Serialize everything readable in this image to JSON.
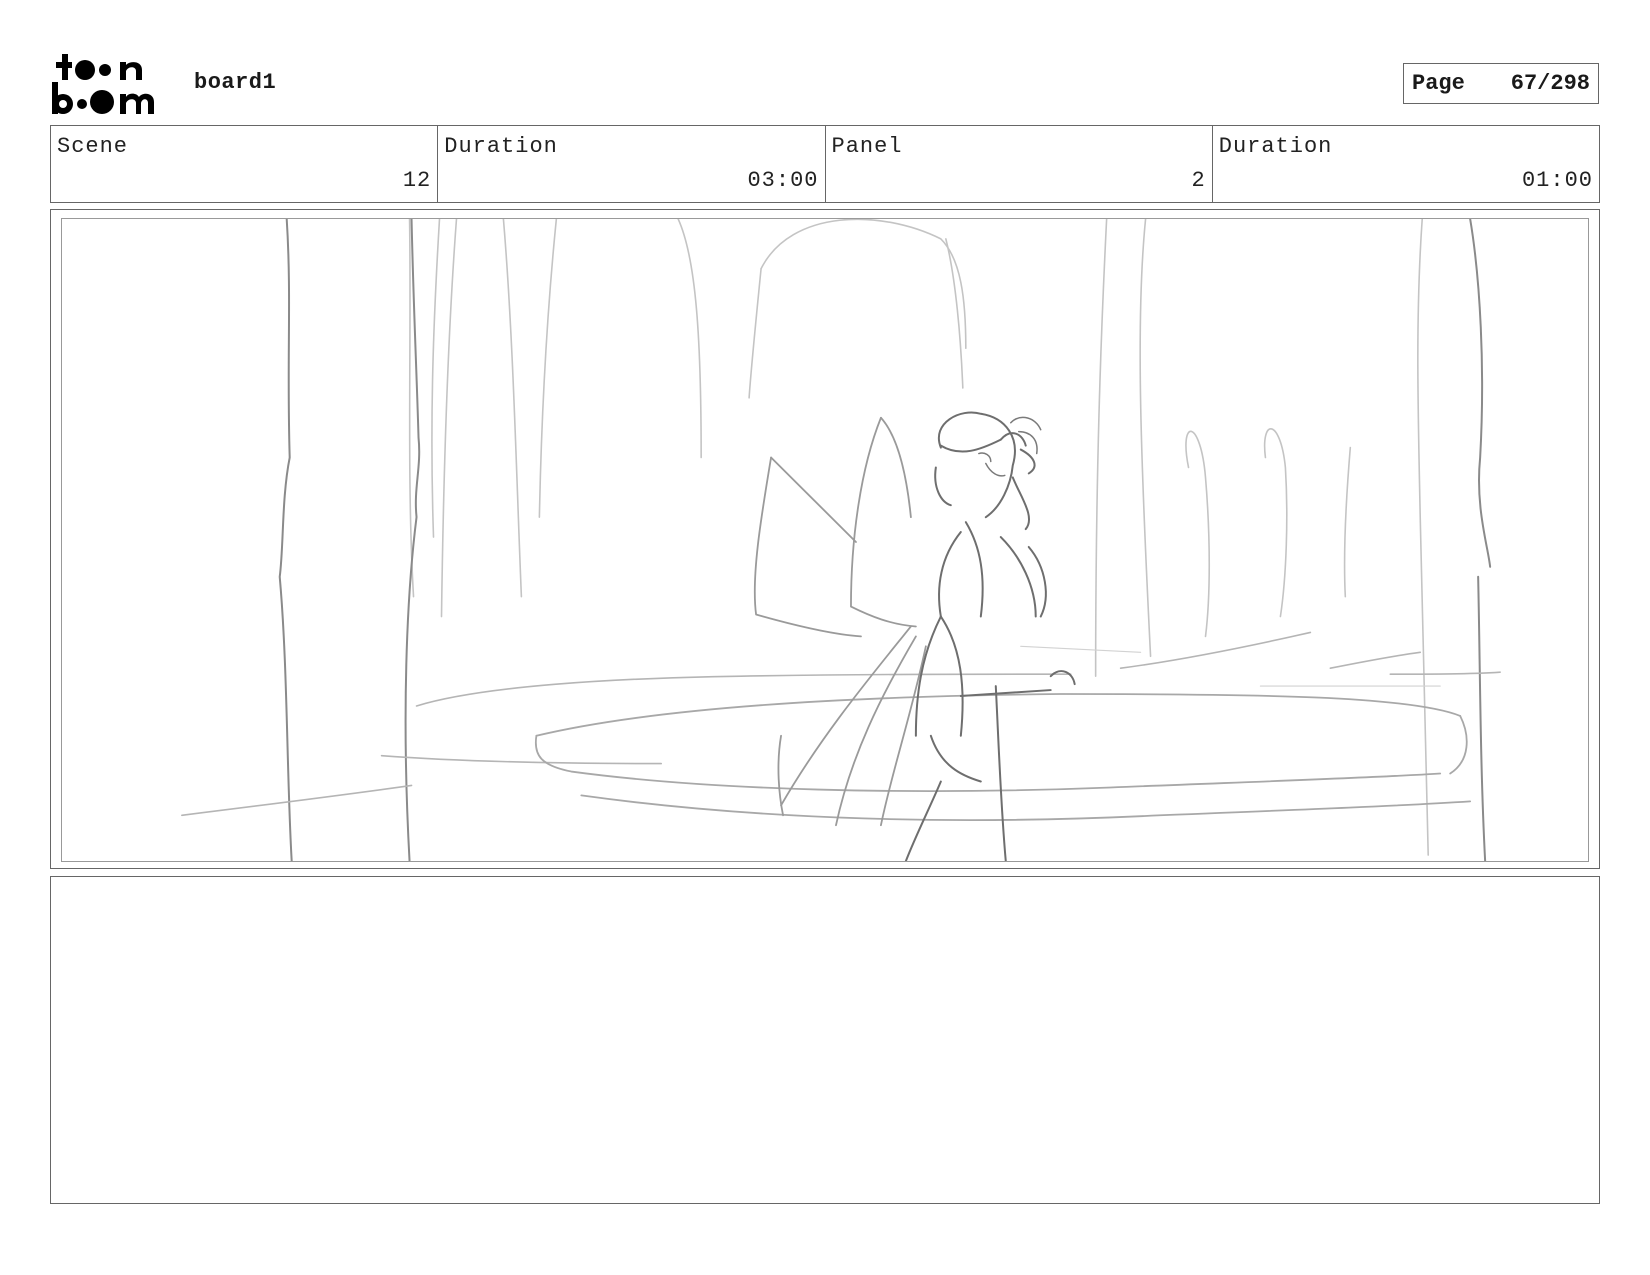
{
  "header": {
    "logo_name": "toonboom-logo",
    "board_title": "board1",
    "page_label": "Page",
    "page_number": "67/298"
  },
  "info": {
    "scene_label": "Scene",
    "scene_value": "12",
    "scene_duration_label": "Duration",
    "scene_duration_value": "03:00",
    "panel_label": "Panel",
    "panel_value": "2",
    "panel_duration_label": "Duration",
    "panel_duration_value": "01:00"
  },
  "panel": {
    "image": "sketch-fairy-forest-pond"
  },
  "notes": {
    "text": ""
  }
}
